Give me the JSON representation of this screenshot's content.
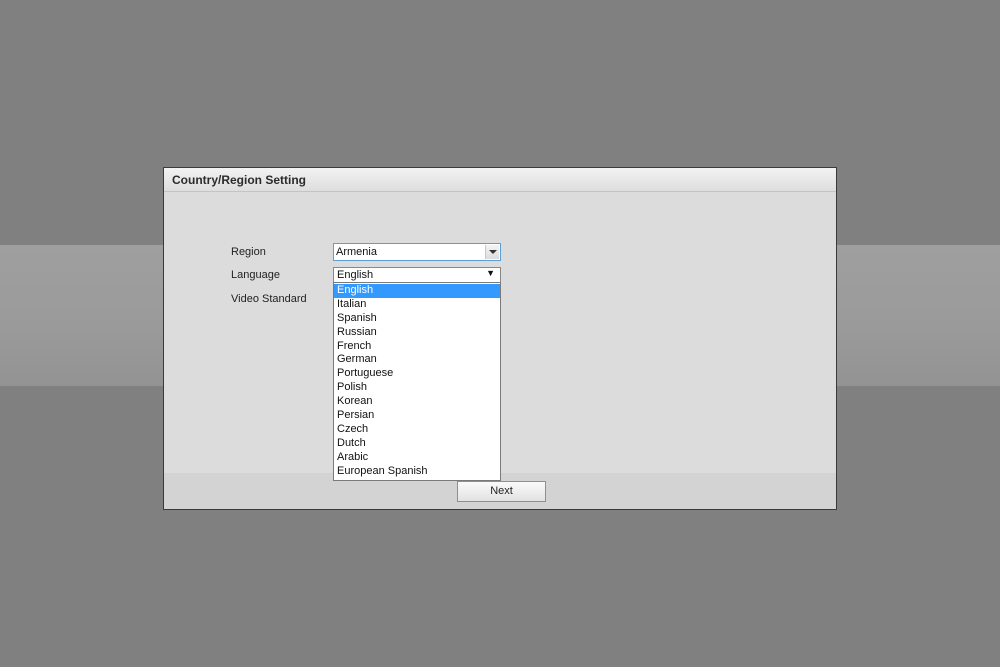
{
  "dialog": {
    "title": "Country/Region Setting"
  },
  "form": {
    "region_label": "Region",
    "region_value": "Armenia",
    "language_label": "Language",
    "language_value": "English",
    "video_standard_label": "Video Standard"
  },
  "language_options": [
    "English",
    "Italian",
    "Spanish",
    "Russian",
    "French",
    "German",
    "Portuguese",
    "Polish",
    "Korean",
    "Persian",
    "Czech",
    "Dutch",
    "Arabic",
    "European Spanish"
  ],
  "selected_language_index": 0,
  "buttons": {
    "next_label": "Next"
  },
  "colors": {
    "selection": "#3399ff",
    "focus_border": "#5aa0d8"
  }
}
